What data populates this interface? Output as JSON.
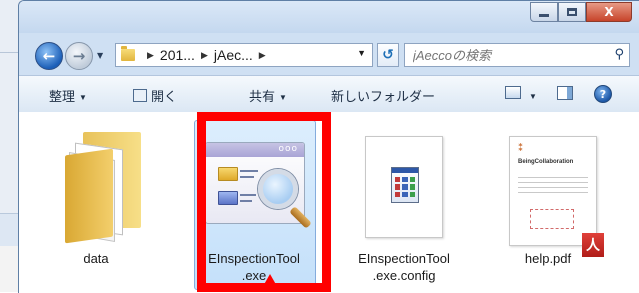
{
  "window": {
    "controls": {
      "minimize_icon": "minimize-icon",
      "maximize_icon": "maximize-icon",
      "close_label": "X"
    }
  },
  "nav": {
    "back_icon": "back-arrow-icon",
    "forward_icon": "forward-arrow-icon",
    "breadcrumb": [
      "201...",
      "jAec..."
    ],
    "refresh_icon": "refresh-icon",
    "search_placeholder": "jAeccoの検索"
  },
  "toolbar": {
    "organize_label": "整理",
    "open_label": "開く",
    "share_label": "共有",
    "new_folder_label": "新しいフォルダー"
  },
  "files": [
    {
      "name": "data",
      "type": "folder"
    },
    {
      "name": "EInspectionTool.exe",
      "display_line1": "EInspectionTool",
      "display_line2": ".exe",
      "type": "application",
      "selected": true
    },
    {
      "name": "EInspectionTool.exe.config",
      "display_line1": "EInspectionTool",
      "display_line2": ".exe.config",
      "type": "config"
    },
    {
      "name": "help.pdf",
      "type": "pdf"
    }
  ],
  "pdf_preview": {
    "title": "BeingCollaboration"
  },
  "colors": {
    "highlight_red": "#ff0000",
    "selection_blue": "#cde6fc",
    "frame_blue": "#cfe0f3"
  }
}
